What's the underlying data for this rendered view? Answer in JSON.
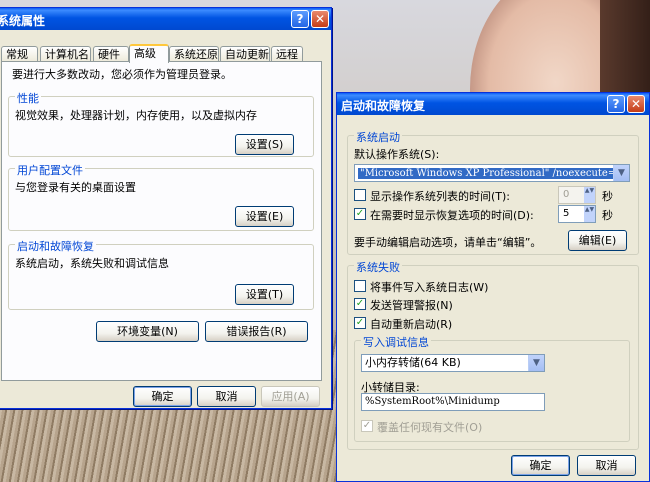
{
  "left_window": {
    "title": "系统属性",
    "tabs": [
      "常规",
      "计算机名",
      "硬件",
      "高级",
      "系统还原",
      "自动更新",
      "远程"
    ],
    "active_tab": "高级",
    "admin_note": "要进行大多数改动，您必须作为管理员登录。",
    "performance": {
      "title": "性能",
      "desc": "视觉效果，处理器计划，内存使用，以及虚拟内存",
      "button": "设置(S)"
    },
    "user_profiles": {
      "title": "用户配置文件",
      "desc": "与您登录有关的桌面设置",
      "button": "设置(E)"
    },
    "startup_recovery": {
      "title": "启动和故障恢复",
      "desc": "系统启动，系统失败和调试信息",
      "button": "设置(T)"
    },
    "env_vars_button": "环境变量(N)",
    "error_report_button": "错误报告(R)",
    "ok": "确定",
    "cancel": "取消",
    "apply": "应用(A)"
  },
  "right_window": {
    "title": "启动和故障恢复",
    "system_startup": {
      "title": "系统启动",
      "default_os_label": "默认操作系统(S):",
      "default_os_value": "\"Microsoft Windows XP Professional\" /noexecute=optin",
      "show_os_list_label": "显示操作系统列表的时间(T):",
      "show_os_list_checked": false,
      "show_os_list_value": "0",
      "show_recovery_label": "在需要时显示恢复选项的时间(D):",
      "show_recovery_checked": true,
      "show_recovery_value": "5",
      "seconds": "秒",
      "edit_hint": "要手动编辑启动选项，请单击“编辑”。",
      "edit_button": "编辑(E)"
    },
    "system_failure": {
      "title": "系统失败",
      "write_event_log": "将事件写入系统日志(W)",
      "write_event_log_checked": false,
      "send_alert": "发送管理警报(N)",
      "send_alert_checked": true,
      "auto_restart": "自动重新启动(R)",
      "auto_restart_checked": true,
      "debug_info": {
        "title": "写入调试信息",
        "dump_type": "小内存转储(64 KB)",
        "dump_dir_label": "小转储目录:",
        "dump_dir_value": "%SystemRoot%\\Minidump",
        "overwrite_label": "覆盖任何现有文件(O)",
        "overwrite_checked": true
      }
    },
    "ok": "确定",
    "cancel": "取消"
  },
  "icons": {
    "help": "?",
    "close": "✕",
    "check": "✓",
    "dropdown": "▼",
    "spin": "▲▼"
  },
  "colors": {
    "titlebar": "#0054e3",
    "window_bg": "#ece9d8",
    "group_title": "#0046d5",
    "selection": "#316ac5"
  }
}
